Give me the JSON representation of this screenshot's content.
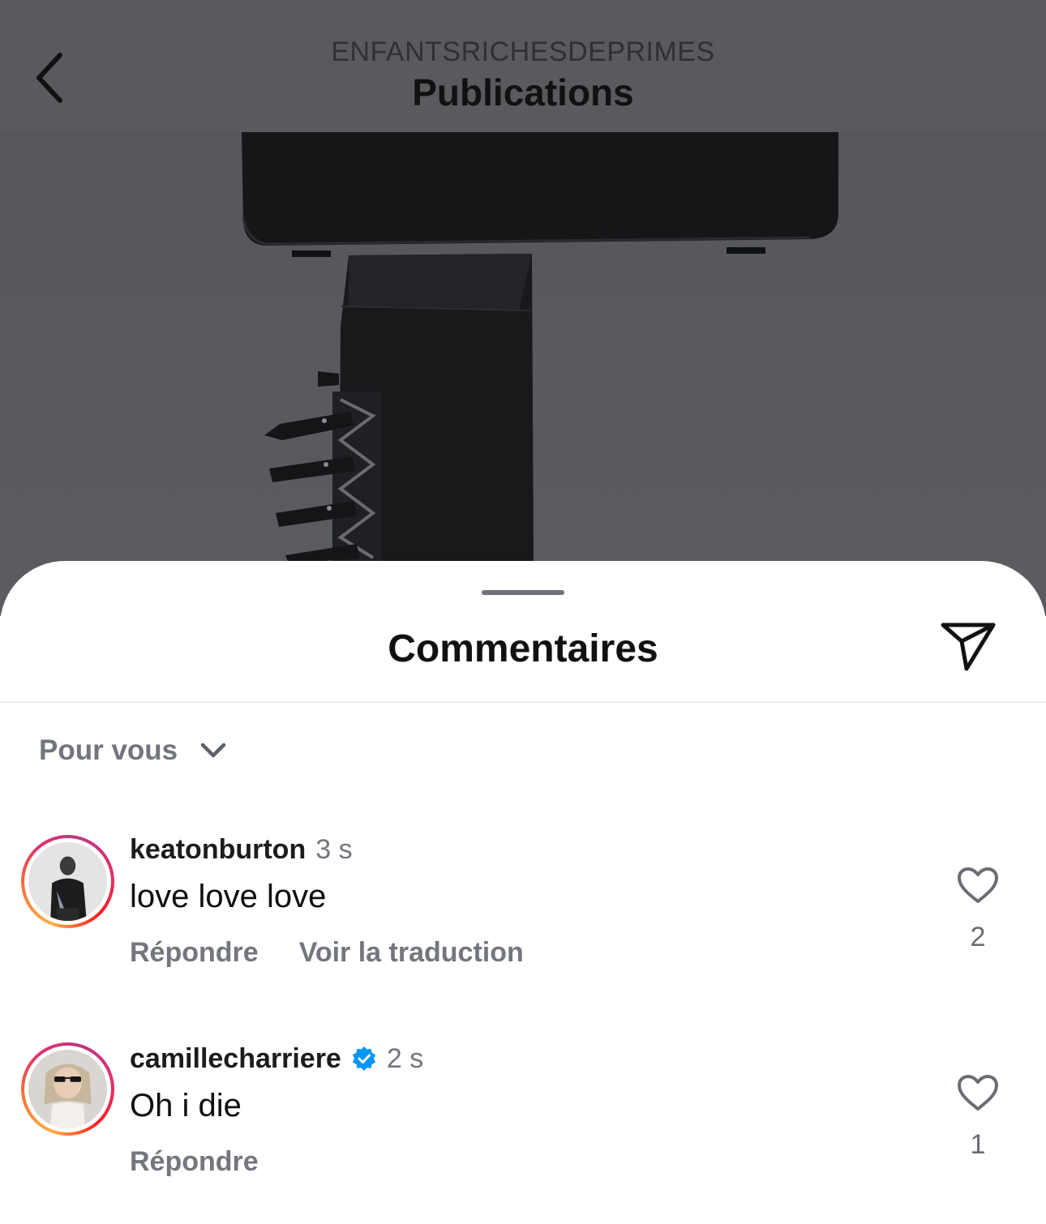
{
  "header": {
    "username": "ENFANTSRICHESDEPRIMES",
    "title": "Publications"
  },
  "comments_sheet": {
    "title": "Commentaires",
    "sort_label": "Pour vous"
  },
  "comments": [
    {
      "username": "keatonburton",
      "verified": false,
      "time": "3 s",
      "text": "love love love",
      "reply_label": "Répondre",
      "translate_label": "Voir la traduction",
      "likes": "2"
    },
    {
      "username": "camillecharriere",
      "verified": true,
      "time": "2 s",
      "text": "Oh i die",
      "reply_label": "Répondre",
      "likes": "1"
    }
  ],
  "colors": {
    "overlay": "#5a5c60",
    "verified_badge": "#0095f6",
    "muted_text": "#73767d"
  }
}
